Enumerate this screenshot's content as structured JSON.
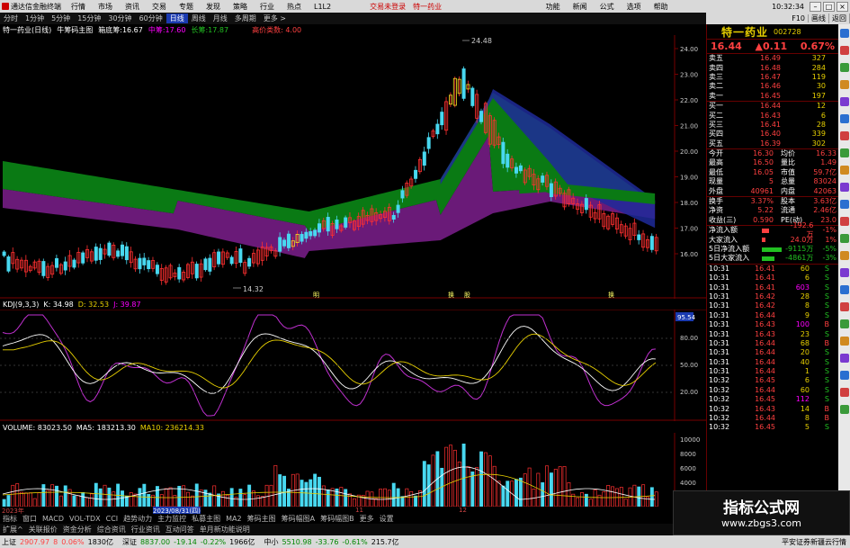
{
  "titlebar": {
    "app": "通达信金融终端",
    "menus": [
      "行情",
      "市场",
      "资讯",
      "交易",
      "专题",
      "发现",
      "策略",
      "行业",
      "热点",
      "L1L2"
    ],
    "login": "交易未登录",
    "stock": "特一药业",
    "right_menus": [
      "功能",
      "新闻",
      "公式",
      "选项",
      "帮助"
    ],
    "time": "10:32:34"
  },
  "periods": [
    "分时",
    "1分钟",
    "5分钟",
    "15分钟",
    "30分钟",
    "60分钟",
    "日线",
    "周线",
    "月线",
    "多周期",
    "更多 >"
  ],
  "active_period": "日线",
  "toolbar2": [
    "F10",
    "画线",
    "返回"
  ],
  "info": {
    "title": "特一药业(日线)",
    "indicator": "牛筹码主图",
    "ma1": "箱底筹:16.67",
    "ma2": "中筹:17.60",
    "ma3": "长筹:17.87",
    "extra": "高价类数: 4.00"
  },
  "kline": {
    "high_label": "24.48",
    "low_label": "14.32",
    "y_labels": [
      "24.00",
      "23.00",
      "22.00",
      "21.00",
      "20.00",
      "19.00",
      "18.00",
      "17.00",
      "16.00"
    ],
    "marks": [
      "明",
      "换",
      "股",
      "换"
    ]
  },
  "kdj": {
    "label": "KDJ(9,3,3)",
    "k": "K: 34.98",
    "d": "D: 32.53",
    "j": "J: 39.87",
    "right_value": "95.54",
    "y_labels": [
      "80.00",
      "50.00",
      "20.00"
    ]
  },
  "volume": {
    "label": "VOLUME: 83023.50",
    "ma5": "MA5: 183213.30",
    "ma10": "MA10: 236214.33",
    "y_labels": [
      "10000",
      "8000",
      "6000",
      "4000",
      "2000"
    ]
  },
  "dates": [
    "2023年",
    "2023/08/31(四)",
    "11",
    "12"
  ],
  "indicator_tabs": [
    "指标",
    "窗口",
    "MACD",
    "VOL-TDX",
    "CCI",
    "趋势动力",
    "主力监控",
    "私募主图",
    "MA2",
    "筹码主图",
    "筹码幅图A",
    "筹码幅图B",
    "更多",
    "设置"
  ],
  "indicator_tabs2": [
    "扩展^",
    "关联报价",
    "资金分析",
    "综合资讯",
    "行业资讯",
    "互动问答",
    "单月新功能说明"
  ],
  "panel": {
    "name": "特一药业",
    "code": "002728",
    "price": "16.44",
    "change": "▲0.11",
    "pct": "0.67%",
    "asks": [
      [
        "卖五",
        "16.49",
        "327"
      ],
      [
        "卖四",
        "16.48",
        "284"
      ],
      [
        "卖三",
        "16.47",
        "119"
      ],
      [
        "卖二",
        "16.46",
        "30"
      ],
      [
        "卖一",
        "16.45",
        "197"
      ]
    ],
    "bids": [
      [
        "买一",
        "16.44",
        "12"
      ],
      [
        "买二",
        "16.43",
        "6"
      ],
      [
        "买三",
        "16.41",
        "28"
      ],
      [
        "买四",
        "16.40",
        "339"
      ],
      [
        "买五",
        "16.39",
        "302"
      ]
    ],
    "stats": [
      [
        "今开",
        "16.30",
        "均价",
        "16.33"
      ],
      [
        "最高",
        "16.50",
        "量比",
        "1.49"
      ],
      [
        "最低",
        "16.05",
        "市值",
        "59.7亿"
      ],
      [
        "现量",
        "5",
        "总量",
        "83024"
      ],
      [
        "外盘",
        "40961",
        "内盘",
        "42063"
      ]
    ],
    "stats2": [
      [
        "换手",
        "3.37%",
        "股本",
        "3.63亿"
      ],
      [
        "净资",
        "5.22",
        "流通",
        "2.46亿"
      ],
      [
        "收益(三)",
        "0.590",
        "PE(动)",
        "23.0"
      ]
    ],
    "flow": [
      [
        "净流入额",
        "-192.6万",
        "-1%"
      ],
      [
        "大家流入",
        "24.0万",
        "1%"
      ],
      [
        "5日净流入额",
        "-9115万",
        "-5%"
      ],
      [
        "5日大家流入",
        "-4861万",
        "-3%"
      ]
    ],
    "ticks": [
      [
        "10:31",
        "16.41",
        "60",
        "S"
      ],
      [
        "10:31",
        "16.41",
        "6",
        "S"
      ],
      [
        "10:31",
        "16.41",
        "603",
        "S"
      ],
      [
        "10:31",
        "16.42",
        "28",
        "S"
      ],
      [
        "10:31",
        "16.42",
        "8",
        "S"
      ],
      [
        "10:31",
        "16.44",
        "9",
        "S"
      ],
      [
        "10:31",
        "16.43",
        "100",
        "B"
      ],
      [
        "10:31",
        "16.43",
        "23",
        "S"
      ],
      [
        "10:31",
        "16.44",
        "68",
        "B"
      ],
      [
        "10:31",
        "16.44",
        "20",
        "S"
      ],
      [
        "10:31",
        "16.44",
        "40",
        "S"
      ],
      [
        "10:31",
        "16.44",
        "1",
        "S"
      ],
      [
        "10:32",
        "16.45",
        "6",
        "S"
      ],
      [
        "10:32",
        "16.44",
        "60",
        "S"
      ],
      [
        "10:32",
        "16.45",
        "112",
        "S"
      ],
      [
        "10:32",
        "16.43",
        "14",
        "B"
      ],
      [
        "10:32",
        "16.44",
        "8",
        "B"
      ],
      [
        "10:32",
        "16.45",
        "5",
        "S"
      ]
    ]
  },
  "status": {
    "sh_label": "上证",
    "sh": "2907.97",
    "sh_chg": "8",
    "sh_pct": "0.06%",
    "sh_amt": "1830亿",
    "sz_label": "深证",
    "sz": "8837.00",
    "sz_chg": "-19.14",
    "sz_pct": "-0.22%",
    "sz_amt": "1966亿",
    "zx_label": "中小",
    "zx": "5510.98",
    "zx_chg": "-33.76",
    "zx_pct": "-0.61%",
    "zx_amt": "215.7亿",
    "broker": "平安证券新疆云行情"
  },
  "watermark": {
    "title": "指标公式网",
    "url": "www.zbgs3.com"
  }
}
